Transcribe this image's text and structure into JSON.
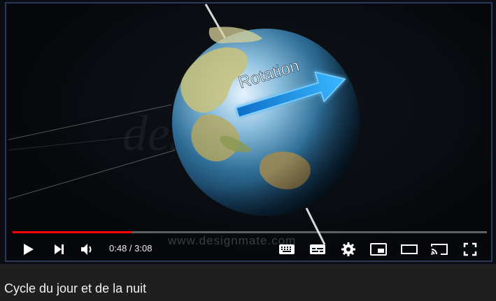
{
  "video": {
    "overlay_label": "Rotation",
    "watermark": "www.designmate.com",
    "watermark_logo": "designmate"
  },
  "player": {
    "progress_fraction": 0.25,
    "current_time": "0:48",
    "duration": "3:08",
    "time_separator": " / ",
    "accent_color": "#ff0000"
  },
  "icons": [
    "play-icon",
    "next-icon",
    "volume-icon",
    "keyboard-icon",
    "subtitles-icon",
    "settings-icon",
    "miniplayer-icon",
    "theater-icon",
    "cast-icon",
    "fullscreen-icon"
  ],
  "title": "Cycle du jour et de la nuit"
}
